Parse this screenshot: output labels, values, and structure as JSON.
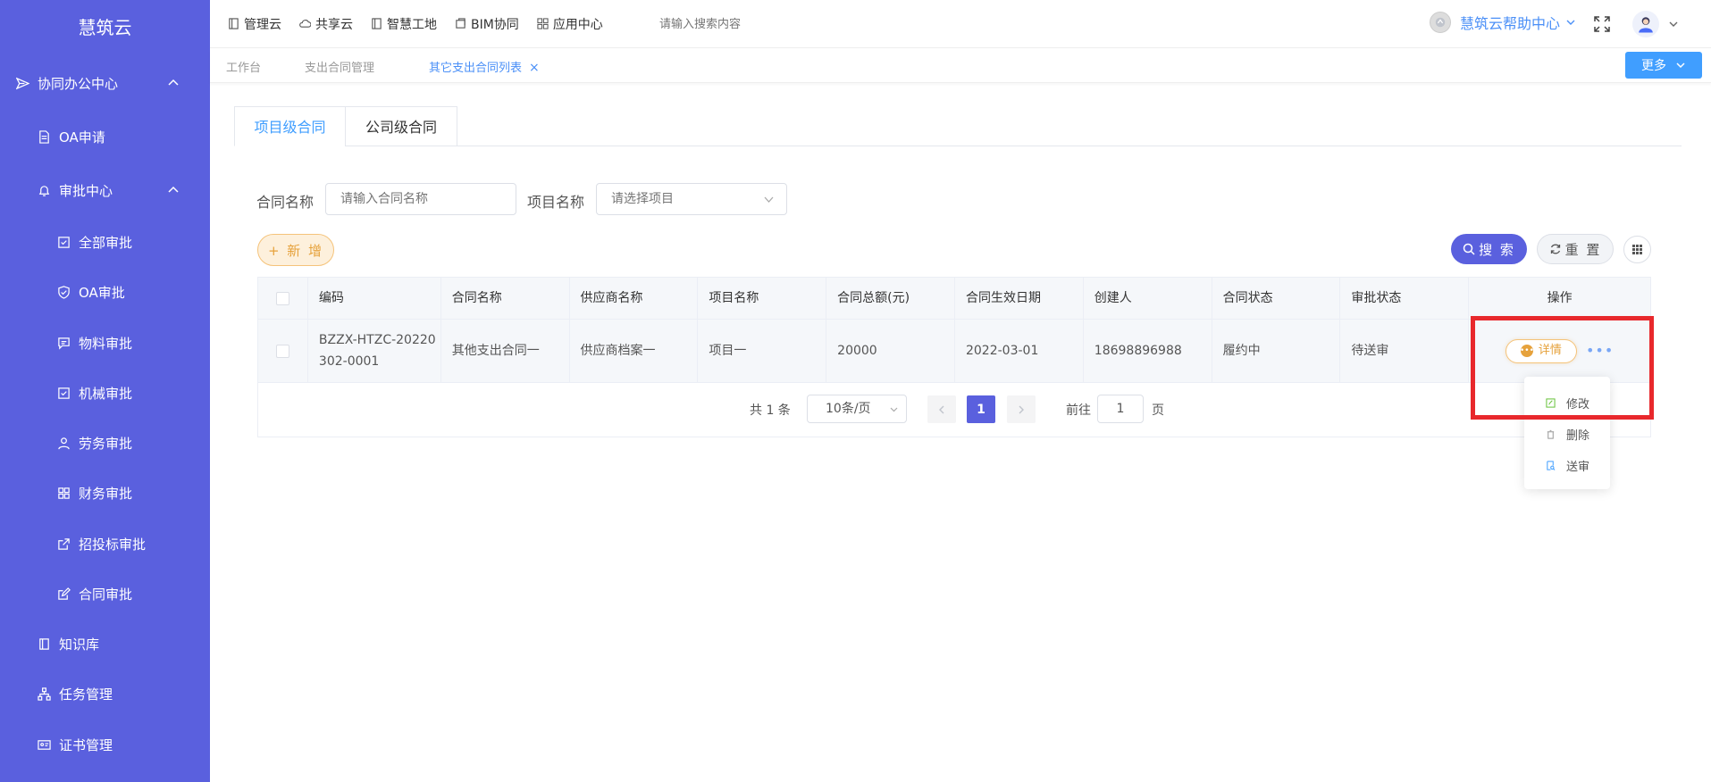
{
  "sidebar": {
    "logo": "慧筑云",
    "items": [
      {
        "label": "协同办公中心"
      },
      {
        "label": "OA申请"
      },
      {
        "label": "审批中心"
      },
      {
        "label": "全部审批"
      },
      {
        "label": "OA审批"
      },
      {
        "label": "物料审批"
      },
      {
        "label": "机械审批"
      },
      {
        "label": "劳务审批"
      },
      {
        "label": "财务审批"
      },
      {
        "label": "招投标审批"
      },
      {
        "label": "合同审批"
      },
      {
        "label": "知识库"
      },
      {
        "label": "任务管理"
      },
      {
        "label": "证书管理"
      }
    ]
  },
  "topbar": {
    "nav": [
      "管理云",
      "共享云",
      "智慧工地",
      "BIM协同",
      "应用中心"
    ],
    "search_placeholder": "请输入搜索内容",
    "help_label": "慧筑云帮助中心"
  },
  "tabsbar": {
    "tabs": [
      "工作台",
      "支出合同管理",
      "其它支出合同列表"
    ],
    "close": "×",
    "more_label": "更多"
  },
  "content": {
    "tabs": [
      "项目级合同",
      "公司级合同"
    ],
    "filters": {
      "contract_name_label": "合同名称",
      "contract_name_placeholder": "请输入合同名称",
      "project_name_label": "项目名称",
      "project_name_placeholder": "请选择项目"
    },
    "add_label": "+ 新 增",
    "search_label": "搜 索",
    "reset_label": "重 置"
  },
  "table": {
    "headers": [
      "编码",
      "合同名称",
      "供应商名称",
      "项目名称",
      "合同总额(元)",
      "合同生效日期",
      "创建人",
      "合同状态",
      "审批状态",
      "操作"
    ],
    "rows": [
      {
        "code_line1": "BZZX-HTZC-20220",
        "code_line2": "302-0001",
        "contract_name": "其他支出合同一",
        "supplier": "供应商档案一",
        "project": "项目一",
        "amount": "20000",
        "effective_date": "2022-03-01",
        "creator": "18698896988",
        "contract_status": "履约中",
        "approval_status": "待送审",
        "detail_label": "详情",
        "more_label": "•••"
      }
    ]
  },
  "pagination": {
    "total": "共 1 条",
    "page_size": "10条/页",
    "current_page": "1",
    "goto_label": "前往",
    "goto_value": "1",
    "page_suffix": "页"
  },
  "dropdown": {
    "items": [
      "修改",
      "删除",
      "送审"
    ]
  },
  "colors": {
    "sidebar_bg": "#5a60de",
    "primary": "#409eff",
    "warning": "#e6a23c",
    "highlight": "#e8282c"
  }
}
